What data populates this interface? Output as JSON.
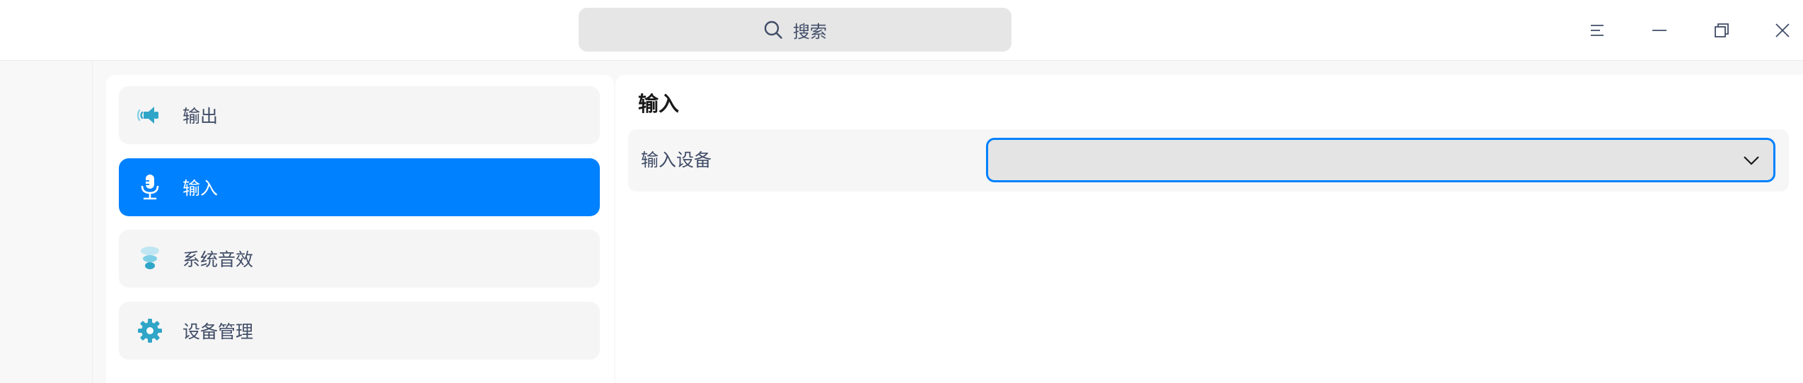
{
  "search": {
    "label": "搜索",
    "icon": "search-icon"
  },
  "titlebar": {
    "buttons": [
      {
        "icon": "menu-icon"
      },
      {
        "icon": "minimize-icon"
      },
      {
        "icon": "maximize-icon"
      },
      {
        "icon": "close-icon"
      }
    ]
  },
  "sidebar": {
    "items": [
      {
        "label": "输出",
        "icon": "speaker-icon",
        "active": false
      },
      {
        "label": "输入",
        "icon": "microphone-icon",
        "active": true
      },
      {
        "label": "系统音效",
        "icon": "sound-effects-icon",
        "active": false
      },
      {
        "label": "设备管理",
        "icon": "gear-icon",
        "active": false
      }
    ]
  },
  "main": {
    "title": "输入",
    "input_device": {
      "label": "输入设备",
      "value": ""
    }
  },
  "colors": {
    "accent": "#0081ff",
    "icon_teal": "#2fa5c7",
    "text": "#414d68",
    "panel_bg": "#ffffff",
    "window_bg": "#f8f8f8"
  }
}
